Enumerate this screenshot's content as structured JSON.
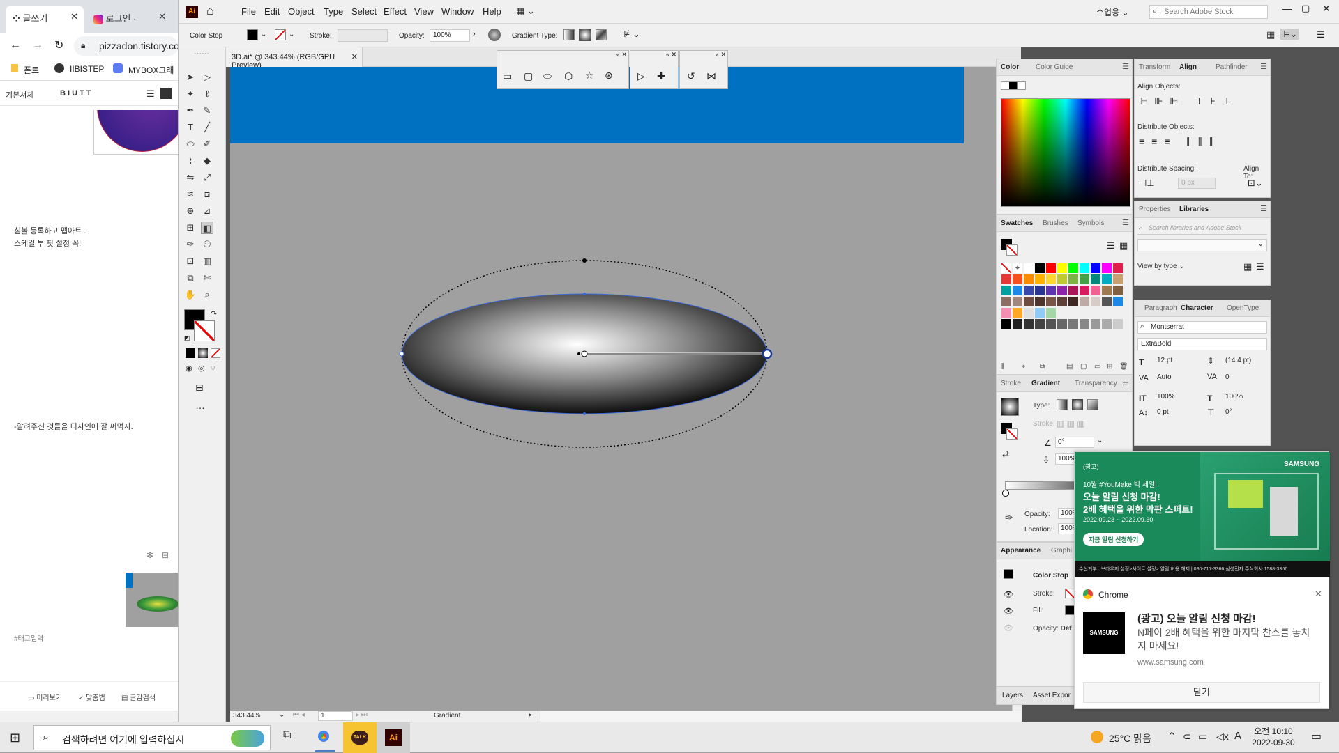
{
  "browser": {
    "tabs": [
      {
        "label": "글쓰기"
      },
      {
        "label": "로그인 ·"
      }
    ],
    "address": "pizzadon.tistory.co",
    "bookmarks": [
      {
        "label": "폰트"
      },
      {
        "label": "IIBISTEP"
      },
      {
        "label": "MYBOX그래"
      }
    ],
    "editor_font": "기본서체",
    "editor_format": "B  I  U  T  T",
    "text1": "심볼 등록하고 맵아트 .",
    "text2": "스케일 투 핏 설정 꼭!",
    "text3": "-알려주신 것들을 디자인에 잘 써먹자.",
    "tag_input": "#태그입력",
    "footer": [
      {
        "label": "미리보기"
      },
      {
        "label": "맞춤법"
      },
      {
        "label": "글감검색"
      }
    ]
  },
  "ai": {
    "logo": "Ai",
    "menus": [
      "File",
      "Edit",
      "Object",
      "Type",
      "Select",
      "Effect",
      "View",
      "Window",
      "Help"
    ],
    "workspace": "수업용",
    "search_placeholder": "Search Adobe Stock",
    "ctrl": {
      "mode": "Color Stop",
      "stroke_label": "Stroke:",
      "opacity_label": "Opacity:",
      "opacity": "100%",
      "gradient_type_label": "Gradient Type:"
    },
    "doc_tab": "3D.ai* @ 343.44% (RGB/GPU Preview)",
    "status": {
      "zoom": "343.44%",
      "artboard": "1",
      "tool": "Gradient"
    },
    "color_panel": {
      "tabs": [
        "Color",
        "Color Guide"
      ]
    },
    "swatches_panel": {
      "tabs": [
        "Swatches",
        "Brushes",
        "Symbols"
      ]
    },
    "gradient_panel": {
      "tabs": [
        "Stroke",
        "Gradient",
        "Transparency"
      ],
      "type_label": "Type:",
      "stroke_label": "Stroke:",
      "angle": "0°",
      "aspect": "100%",
      "opacity_label": "Opacity:",
      "opacity": "100%",
      "location_label": "Location:",
      "location": "100%"
    },
    "appearance_panel": {
      "tabs": [
        "Appearance",
        "Graphi"
      ],
      "title": "Color Stop",
      "stroke_label": "Stroke:",
      "fill_label": "Fill:",
      "opacity_label": "Opacity:",
      "opacity_value": "Def"
    },
    "layers_tabs": [
      "Layers",
      "Asset Expor"
    ],
    "align_panel": {
      "tabs": [
        "Transform",
        "Align",
        "Pathfinder"
      ],
      "align_objects": "Align Objects:",
      "distribute_objects": "Distribute Objects:",
      "distribute_spacing": "Distribute Spacing:",
      "align_to": "Align To:",
      "spacing_value": "0 px"
    },
    "libraries_panel": {
      "tabs": [
        "Properties",
        "Libraries"
      ],
      "search_placeholder": "Search libraries and Adobe Stock",
      "view_by": "View by type"
    },
    "character_panel": {
      "tabs": [
        "Paragraph",
        "Character",
        "OpenType"
      ],
      "font": "Montserrat",
      "style": "ExtraBold",
      "size": "12 pt",
      "leading": "(14.4 pt)",
      "kerning": "Auto",
      "tracking": "0",
      "vscale": "100%",
      "hscale": "100%",
      "baseline": "0 pt",
      "rotation": "0°"
    }
  },
  "notification": {
    "ad_tag": "(광고)",
    "ad_brand": "SAMSUNG",
    "ad_line1": "10월 #YouMake 빅 세일!",
    "ad_line2": "오늘 알림 신청 마감!",
    "ad_line3": "2배 혜택을 위한 막판 스퍼트!",
    "ad_date": "2022.09.23 ~ 2022.09.30",
    "ad_button": "지금 알림 신청하기",
    "ad_footer": "수신거부 : 브라우저 설정>사이트 설정> 알림 허용 해제 | 080-717-3366 삼성전자 주식회사 1588-3366",
    "app": "Chrome",
    "title": "(광고) 오늘 알림 신청 마감!",
    "body": "N페이 2배 혜택을 위한 마지막 찬스를 놓치지 마세요!",
    "source": "www.samsung.com",
    "logo": "SAMSUNG",
    "close_button": "닫기"
  },
  "taskbar": {
    "search": "검색하려면 여기에 입력하십시",
    "weather": "25°C 맑음",
    "time": "오전 10:10",
    "date": "2022-09-30",
    "ime": "A",
    "kakao": "TALK",
    "ai": "Ai"
  },
  "colors": {
    "canvas_blue": "#0070c0",
    "canvas_gray": "#a0a0a0",
    "selection": "#3a66d8"
  }
}
